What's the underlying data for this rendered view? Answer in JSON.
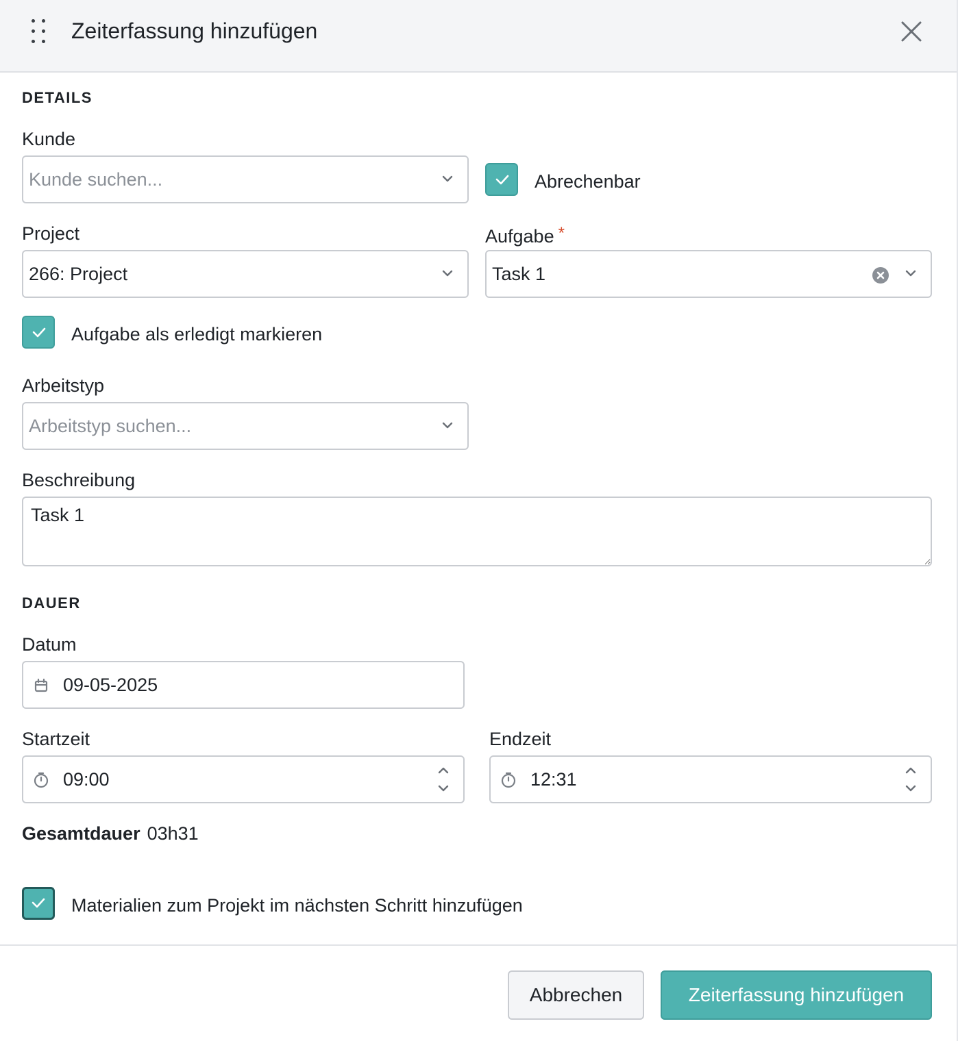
{
  "header": {
    "title": "Zeiterfassung hinzufügen",
    "drag_icon": "drag-handle-icon",
    "close_icon": "close-icon"
  },
  "details": {
    "section_title": "DETAILS",
    "customer": {
      "label": "Kunde",
      "placeholder": "Kunde suchen..."
    },
    "billable": {
      "label": "Abrechenbar",
      "checked": true
    },
    "project": {
      "label": "Project",
      "value": "266: Project"
    },
    "task": {
      "label": "Aufgabe",
      "required_marker": "*",
      "value": "Task 1"
    },
    "mark_done": {
      "label": "Aufgabe als erledigt markieren",
      "checked": true
    },
    "work_type": {
      "label": "Arbeitstyp",
      "placeholder": "Arbeitstyp suchen..."
    },
    "description": {
      "label": "Beschreibung",
      "value": "Task 1"
    }
  },
  "duration": {
    "section_title": "DAUER",
    "date": {
      "label": "Datum",
      "value": "09-05-2025"
    },
    "start": {
      "label": "Startzeit",
      "value": "09:00"
    },
    "end": {
      "label": "Endzeit",
      "value": "12:31"
    },
    "total": {
      "label": "Gesamtdauer",
      "value": "03h31"
    }
  },
  "materials": {
    "label": "Materialien zum Projekt im nächsten Schritt hinzufügen",
    "checked": true
  },
  "footer": {
    "cancel_label": "Abbrechen",
    "submit_label": "Zeiterfassung hinzufügen"
  },
  "colors": {
    "accent": "#4fb3b0",
    "required": "#d64a2a",
    "header_bg": "#f4f5f7"
  }
}
